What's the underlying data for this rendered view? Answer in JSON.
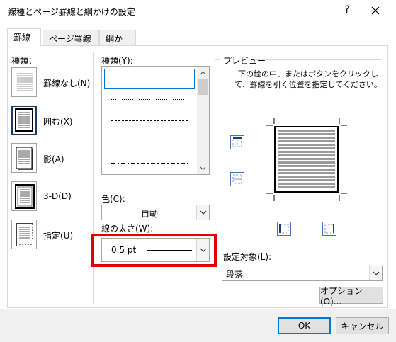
{
  "window": {
    "title": "線種とページ罫線と網かけの設定",
    "help": "?",
    "close_icon": "close-icon"
  },
  "tabs": [
    {
      "label": "罫線",
      "active": true
    },
    {
      "label": "ページ罫線",
      "active": false
    },
    {
      "label": "網かけ",
      "active": false
    }
  ],
  "settings": {
    "heading": "種類：",
    "items": [
      {
        "label": "罫線なし(N)",
        "icon": "no-border-icon"
      },
      {
        "label": "囲む(X)",
        "icon": "box-border-icon",
        "selected": true
      },
      {
        "label": "影(A)",
        "icon": "shadow-border-icon"
      },
      {
        "label": "3-D(D)",
        "icon": "3d-border-icon"
      },
      {
        "label": "指定(U)",
        "icon": "custom-border-icon"
      }
    ]
  },
  "style": {
    "heading": "種類(Y):",
    "items": [
      "solid",
      "dotted",
      "dashed-small",
      "dashed",
      "dash-dot"
    ],
    "selected_index": 0
  },
  "color": {
    "label": "色(C):",
    "value": "自動"
  },
  "width": {
    "label": "線の太さ(W):",
    "value": "0.5 pt"
  },
  "preview": {
    "heading": "プレビュー",
    "description": "下の絵の中、またはボタンをクリックして、罫線を引く位置を指定してください。"
  },
  "apply_to": {
    "label": "設定対象(L):",
    "value": "段落"
  },
  "buttons": {
    "options": "オプション(O)...",
    "ok": "OK",
    "cancel": "キャンセル"
  },
  "colors": {
    "highlight": "#e00000",
    "accent": "#0078d7"
  }
}
